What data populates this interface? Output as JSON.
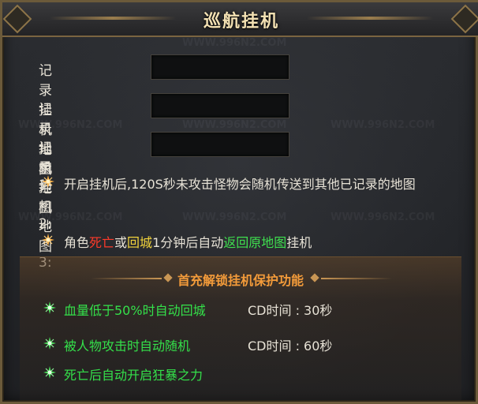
{
  "title": "巡航挂机",
  "watermark": "WWW.996N2.COM",
  "maps": [
    {
      "label": "记录挂机地图1:",
      "value": ""
    },
    {
      "label": "记录挂机地图2:",
      "value": ""
    },
    {
      "label": "记录挂机地图3:",
      "value": ""
    }
  ],
  "info1": "开启挂机后,120S秒未攻击怪物会随机传送到其他已记录的地图",
  "info2": {
    "p1": "角色",
    "death": "死亡",
    "p2": "或",
    "return_city": "回城",
    "p3": "1分钟后自动",
    "return_map": "返回原地图",
    "p4": "挂机"
  },
  "bonus": {
    "title": "首充解锁挂机保护功能",
    "items": [
      {
        "text": "血量低于50%时自动回城",
        "cd": "CD时间 : 30秒"
      },
      {
        "text": "被人物攻击时自动随机",
        "cd": "CD时间 : 60秒"
      },
      {
        "text": "死亡后自动开启狂暴之力",
        "cd": ""
      }
    ]
  },
  "colors": {
    "accent_red": "#ff3a2a",
    "accent_yellow": "#f2d43c",
    "accent_green": "#3fe04f",
    "title_gold": "#f3e1b3",
    "bonus_orange": "#f39b3a"
  },
  "icons": {
    "orange_star": "orange-star-icon",
    "green_star": "green-star-icon"
  }
}
